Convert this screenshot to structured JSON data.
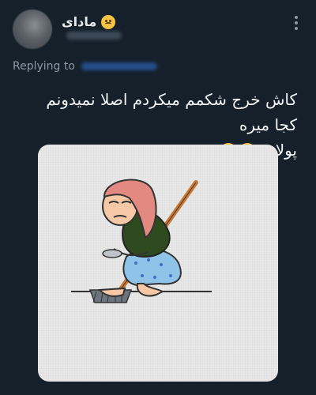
{
  "tweet": {
    "display_name": "مادای",
    "reply_prefix": "Replying to",
    "text_line1": "کاش خرج شکمم میکردم اصلا نمیدونم کجا میره",
    "text_line2": "پولام"
  },
  "icons": {
    "name_emoji": "woozy-face-icon",
    "text_emojis": [
      "smiling-face-with-tear-icon",
      "crying-laughing-face-icon"
    ],
    "more": "more-options-icon"
  },
  "colors": {
    "background": "#15202b",
    "text": "#e7e9ea",
    "secondary": "#8b98a5",
    "media_bg": "#e9e8e8"
  }
}
